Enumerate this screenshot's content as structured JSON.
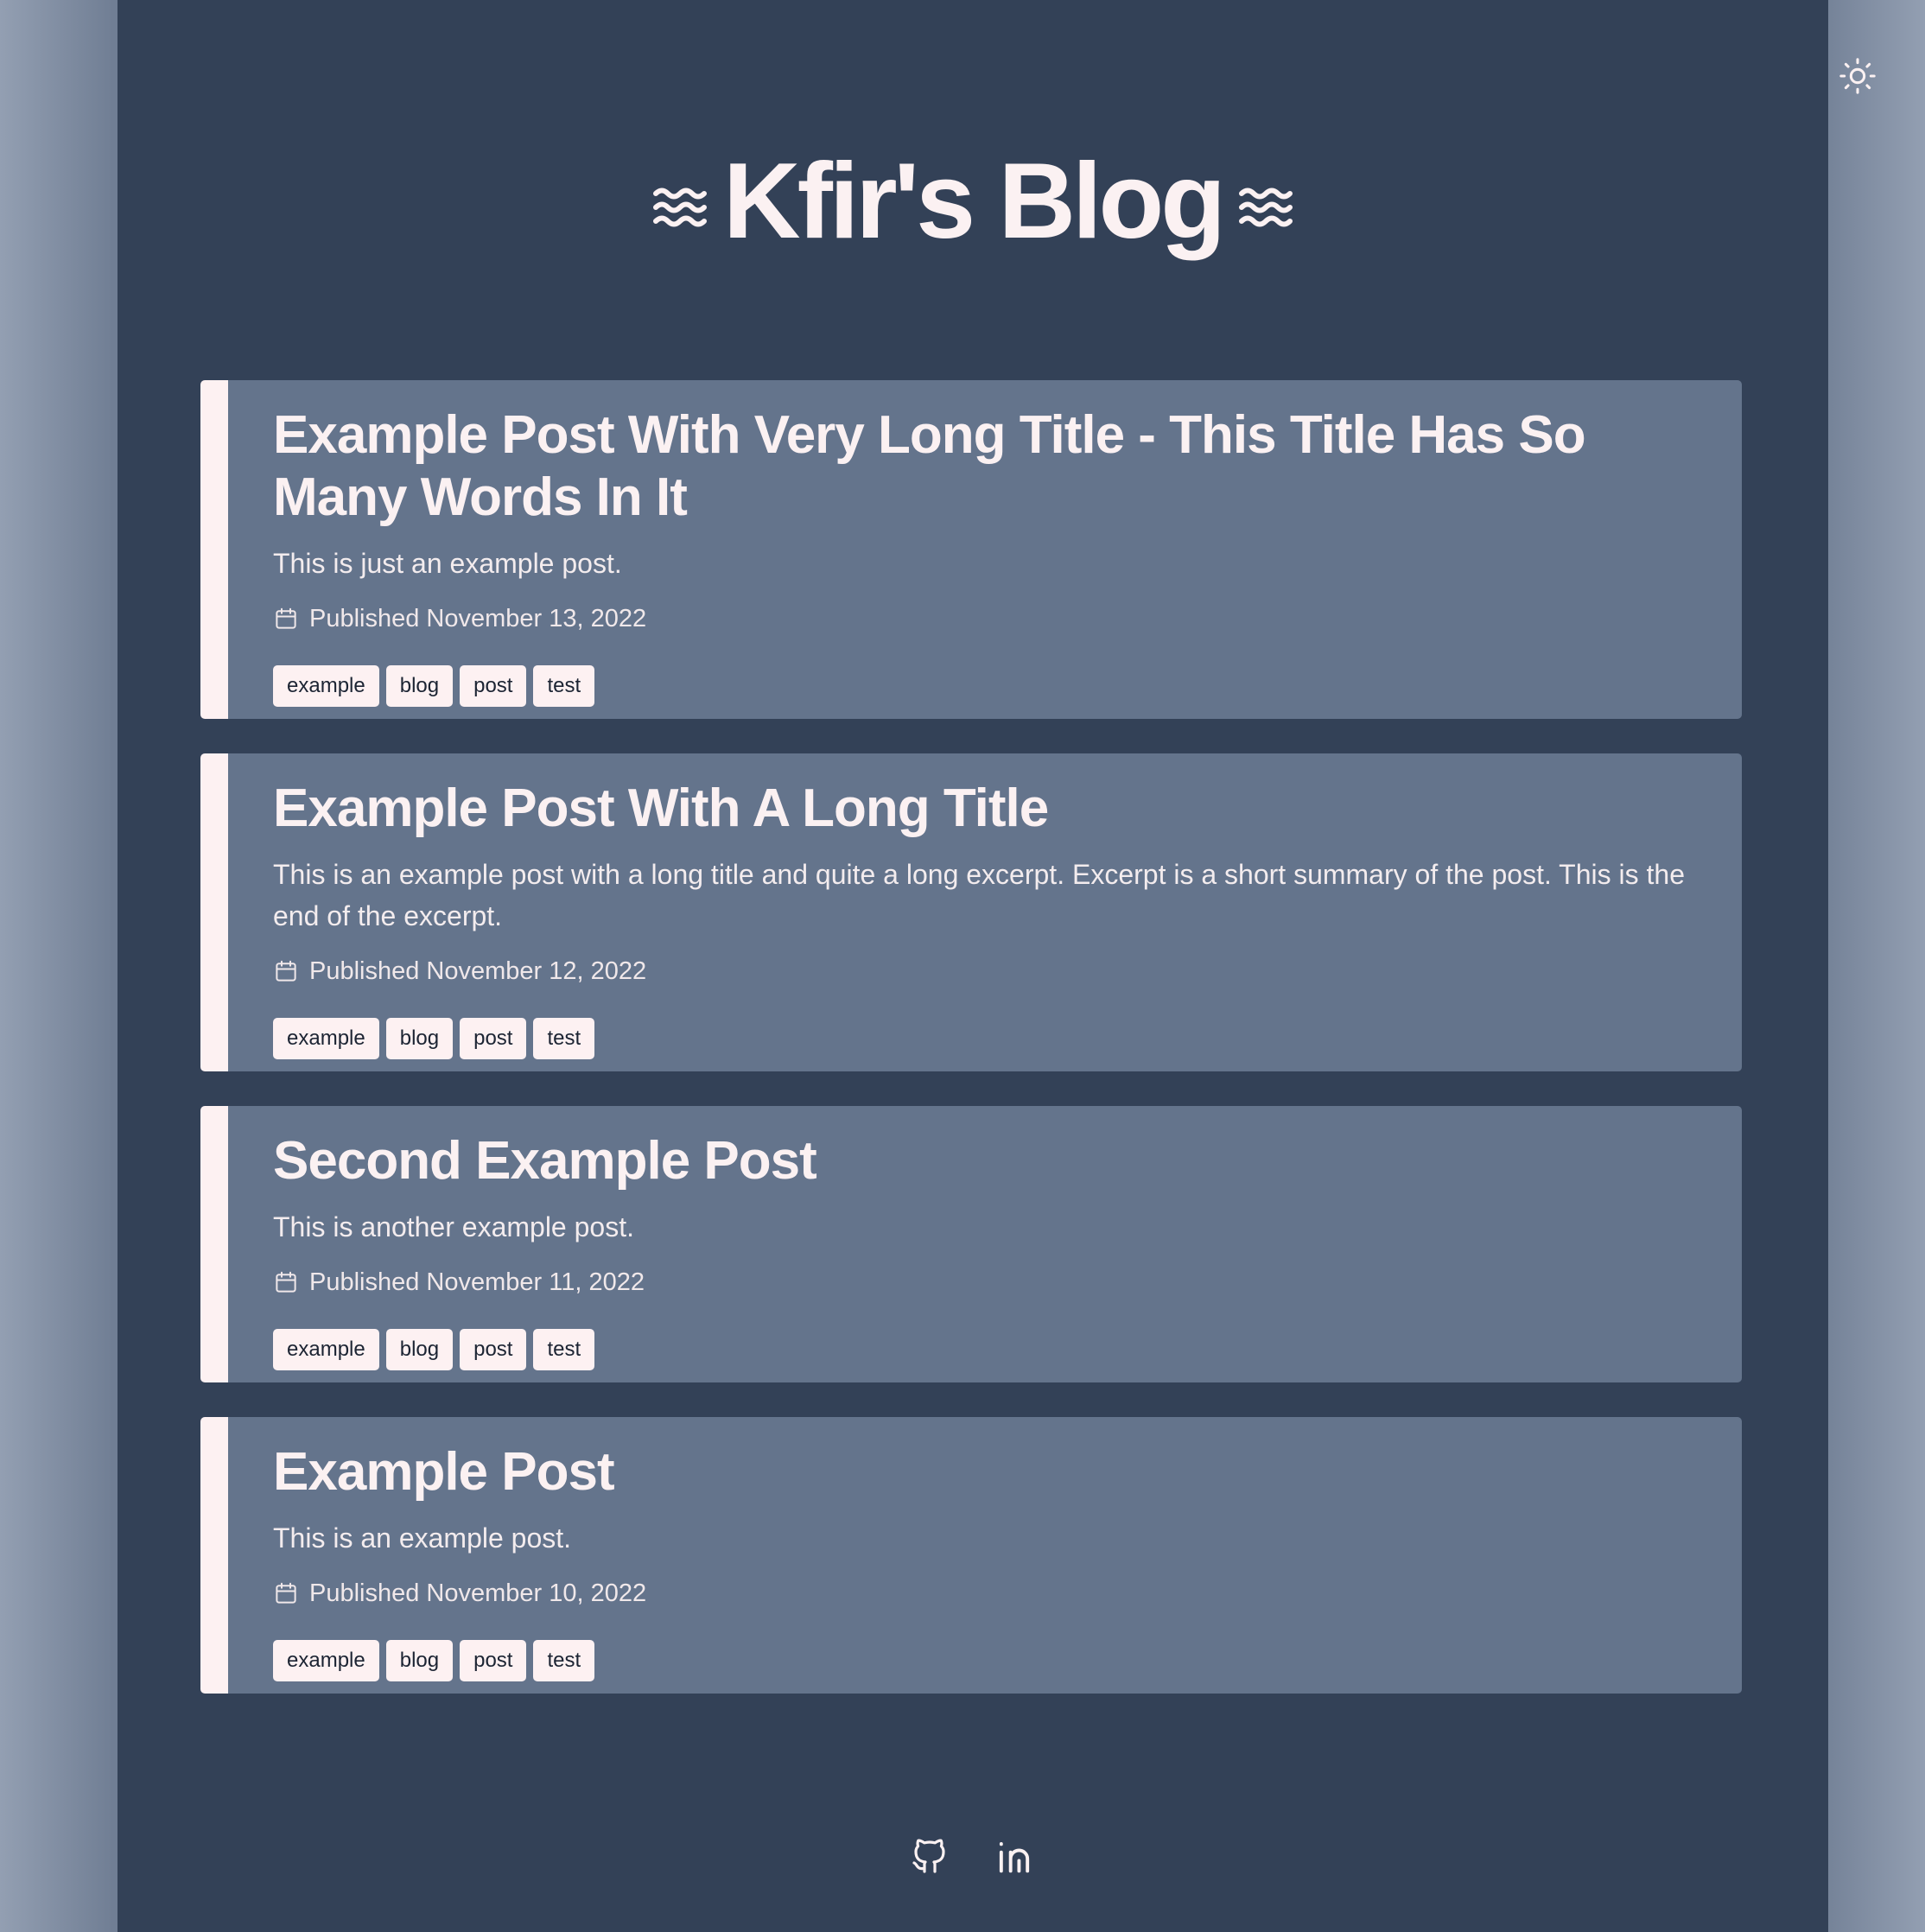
{
  "site": {
    "title": "Kfir's Blog",
    "theme_toggle_icon": "sun-icon",
    "header_icons": [
      "waves-icon",
      "waves-icon"
    ]
  },
  "posts": [
    {
      "title": "Example Post With Very Long Title - This Title Has So Many Words In It",
      "excerpt": "This is just an example post.",
      "published": "Published November 13, 2022",
      "tags": [
        "example",
        "blog",
        "post",
        "test"
      ]
    },
    {
      "title": "Example Post With A Long Title",
      "excerpt": "This is an example post with a long title and quite a long excerpt. Excerpt is a short summary of the post. This is the end of the excerpt.",
      "published": "Published November 12, 2022",
      "tags": [
        "example",
        "blog",
        "post",
        "test"
      ]
    },
    {
      "title": "Second Example Post",
      "excerpt": "This is another example post.",
      "published": "Published November 11, 2022",
      "tags": [
        "example",
        "blog",
        "post",
        "test"
      ]
    },
    {
      "title": "Example Post",
      "excerpt": "This is an example post.",
      "published": "Published November 10, 2022",
      "tags": [
        "example",
        "blog",
        "post",
        "test"
      ]
    }
  ],
  "footer": {
    "links": [
      "github-icon",
      "linkedin-icon"
    ]
  },
  "colors": {
    "page_background": "#334157",
    "card_background": "#64748c",
    "accent": "#fdf1f2",
    "text": "#fbf1f2"
  }
}
